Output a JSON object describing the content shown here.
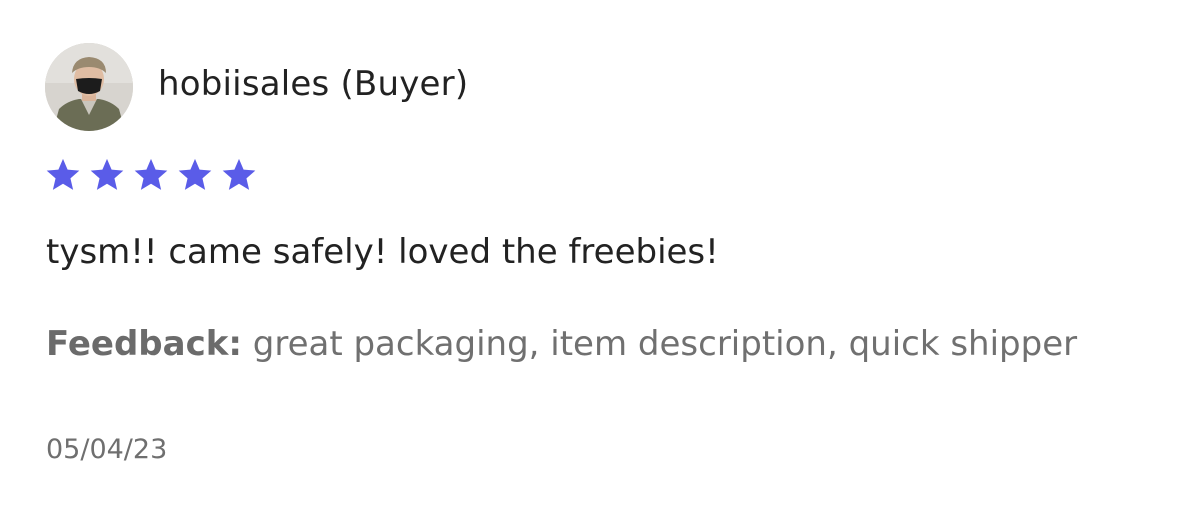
{
  "review": {
    "reviewer_name": "hobiisales (Buyer)",
    "avatar_icon": "user-avatar-photo",
    "rating": 5,
    "rating_max": 5,
    "star_color": "#5a5ce8",
    "comment": "tysm!! came safely! loved the freebies!",
    "feedback_label": "Feedback:",
    "feedback_text": "great packaging, item description, quick shipper",
    "date": "05/04/23"
  }
}
